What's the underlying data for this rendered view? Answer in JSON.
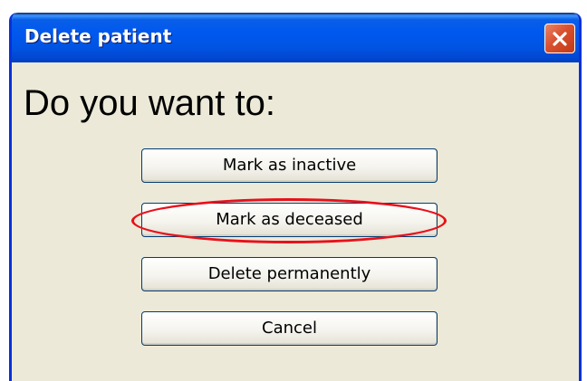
{
  "window": {
    "title": "Delete patient",
    "close_icon": "close-icon"
  },
  "dialog": {
    "heading": "Do you want to:",
    "buttons": [
      {
        "label": "Mark as inactive"
      },
      {
        "label": "Mark as deceased",
        "highlighted": true
      },
      {
        "label": "Delete permanently"
      },
      {
        "label": "Cancel"
      }
    ]
  },
  "colors": {
    "titlebar": "#0054e3",
    "dialog_background": "#ece9d8",
    "close_button": "#d9502f",
    "highlight_annotation": "#e8101a"
  }
}
